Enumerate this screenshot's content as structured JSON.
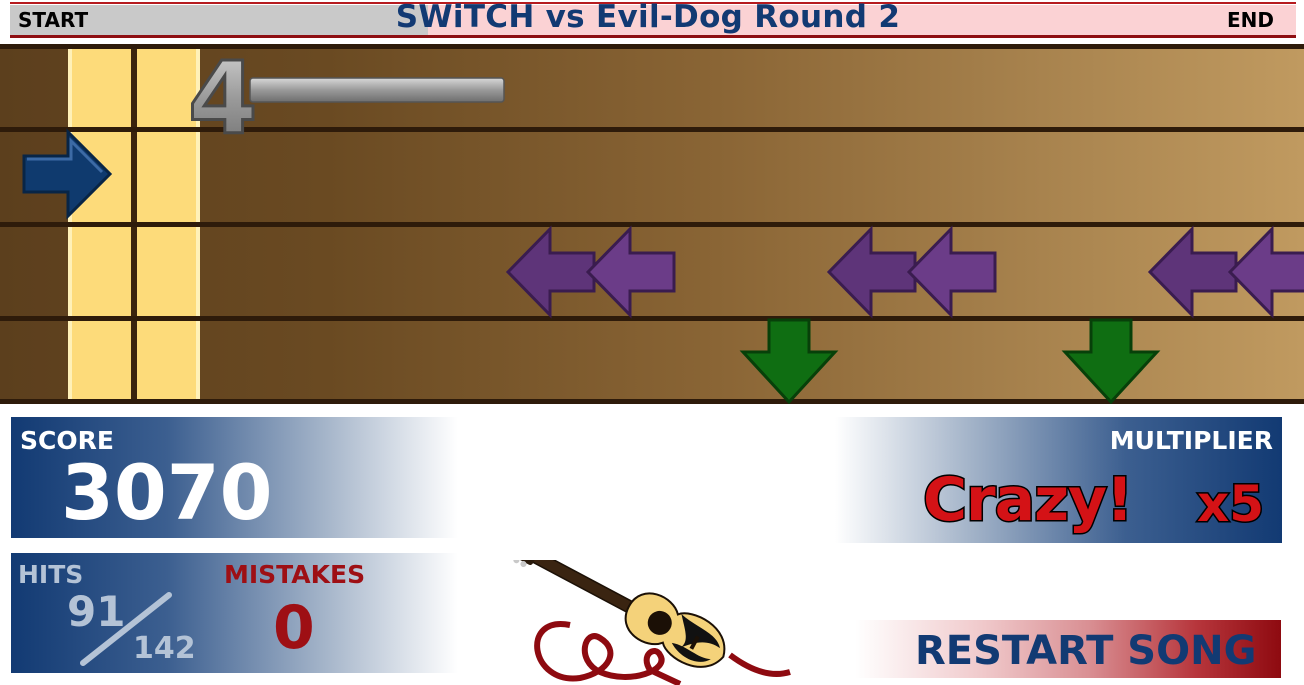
{
  "header": {
    "start_label": "START",
    "song_title": "SWiTCH vs Evil-Dog Round 2",
    "end_label": "END"
  },
  "board": {
    "countdown": "4",
    "lanes": 4,
    "notes": [
      {
        "lane": 1,
        "direction": "right",
        "color": "#103f78"
      },
      {
        "lane": 2,
        "direction": "left",
        "color": "#5e3479"
      },
      {
        "lane": 2,
        "direction": "left",
        "color": "#5e3479"
      },
      {
        "lane": 2,
        "direction": "left",
        "color": "#5e3479"
      },
      {
        "lane": 2,
        "direction": "left",
        "color": "#5e3479"
      },
      {
        "lane": 2,
        "direction": "left",
        "color": "#5e3479"
      },
      {
        "lane": 2,
        "direction": "left",
        "color": "#5e3479"
      },
      {
        "lane": 3,
        "direction": "down",
        "color": "#0f6e12"
      },
      {
        "lane": 3,
        "direction": "down",
        "color": "#0f6e12"
      }
    ]
  },
  "score": {
    "label": "SCORE",
    "value": "3070"
  },
  "hits": {
    "label": "HITS",
    "value": "91",
    "total": "142"
  },
  "mistakes": {
    "label": "MISTAKES",
    "value": "0"
  },
  "multiplier": {
    "label": "MULTIPLIER",
    "word": "Crazy!",
    "value": "x5"
  },
  "restart": {
    "label": "RESTART SONG"
  },
  "colors": {
    "navy": "#123a73",
    "crimson": "#9e0f14",
    "hit_zone": "#fddb7a"
  },
  "logo": {
    "icon": "guitar-icon"
  }
}
